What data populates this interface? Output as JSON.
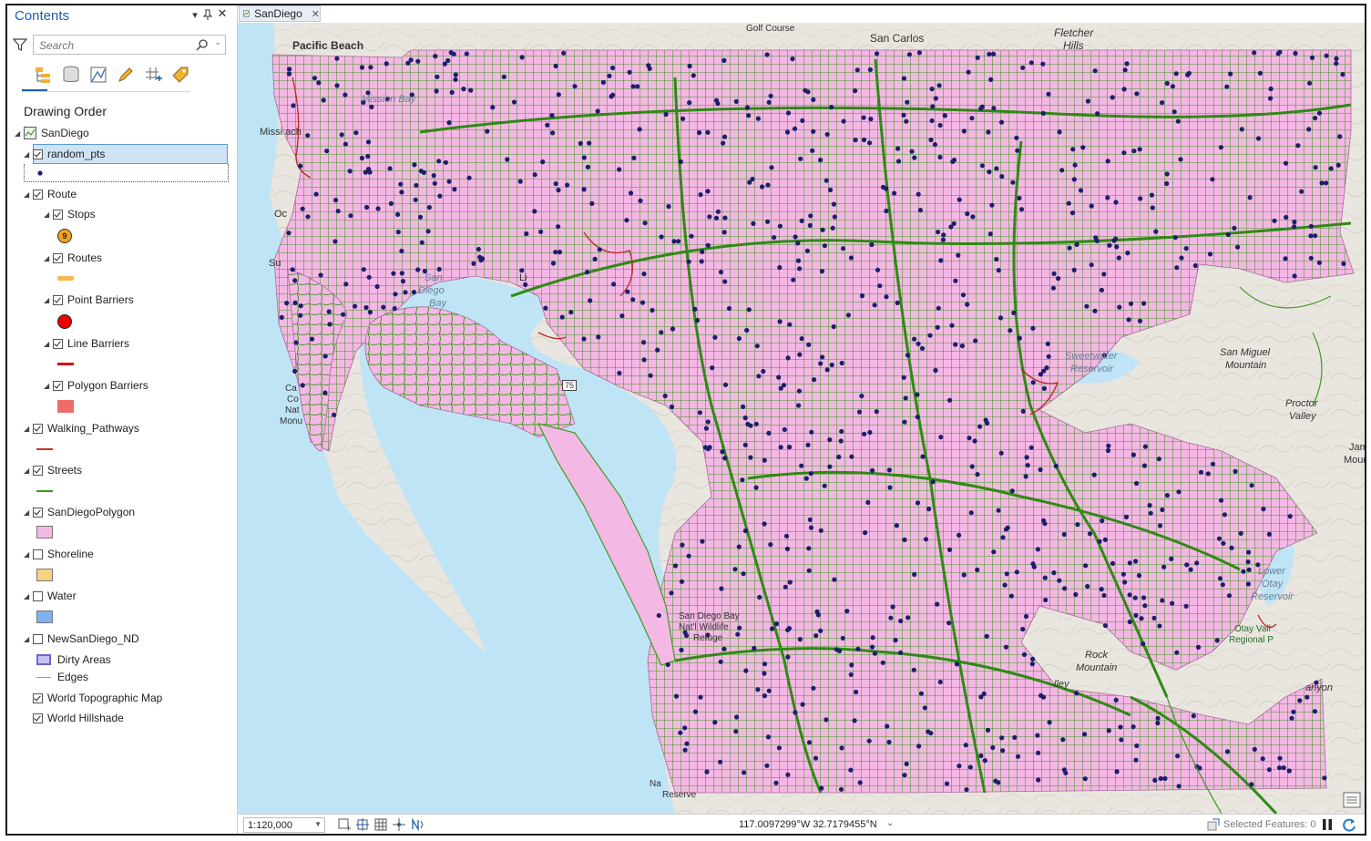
{
  "contents_pane": {
    "title": "Contents",
    "search_placeholder": "Search",
    "section_title": "Drawing Order",
    "layers": [
      {
        "name": "SanDiego"
      },
      {
        "name": "random_pts"
      },
      {
        "name": "Route"
      },
      {
        "name": "Stops",
        "symbol_label": "9"
      },
      {
        "name": "Routes"
      },
      {
        "name": "Point Barriers"
      },
      {
        "name": "Line Barriers"
      },
      {
        "name": "Polygon Barriers"
      },
      {
        "name": "Walking_Pathways"
      },
      {
        "name": "Streets"
      },
      {
        "name": "SanDiegoPolygon"
      },
      {
        "name": "Shoreline"
      },
      {
        "name": "Water"
      },
      {
        "name": "NewSanDiego_ND"
      },
      {
        "name": "Dirty Areas"
      },
      {
        "name": "Edges"
      },
      {
        "name": "World Topographic Map"
      },
      {
        "name": "World Hillshade"
      }
    ]
  },
  "map_view": {
    "tab_title": "SanDiego",
    "labels": {
      "pacific_beach": "Pacific Beach",
      "mission_bay": "Mission Bay",
      "mission_beach": "Missi         ach",
      "golf_course": "Golf Course",
      "san_carlos": "San Carlos",
      "fletcher_hills": "Fletcher",
      "fletcher_hills2": "Hills",
      "san_diego_bay1": "San",
      "san_diego_bay2": "Diego",
      "san_diego_bay3": "Bay",
      "sweetwater1": "Sweetwater",
      "sweetwater2": "Reservoir",
      "san_miguel1": "San Miguel",
      "san_miguel2": "Mountain",
      "proctor1": "Proctor",
      "proctor2": "Valley",
      "jamul1": "Jam",
      "jamul2": "Moun",
      "lower_otay1": "Lower",
      "lower_otay2": "Otay",
      "lower_otay3": "Reservoir",
      "otay_valley1": "Otay Vall",
      "otay_valley2": "Regional P",
      "refuge1": "San Diego Bay",
      "refuge2": "Nat'l Wildlife",
      "refuge3": "Refuge",
      "rock1": "Rock",
      "rock2": "Mountain",
      "canyon": "anyon",
      "reserve": "Reserve",
      "hwy": "75",
      "ocean_label": "Oc",
      "su_label": "Su",
      "li_label": "Li",
      "ca_label": "Ca",
      "co_label": "Co",
      "nat_label": "Nat",
      "monu_label": "Monu",
      "na_label": "Na",
      "lley_label": "lley"
    },
    "colors": {
      "city_polygon": "#f4b8e4",
      "streets": "#3e9b1f",
      "walking": "#b8281c",
      "points": "#1b1f6b",
      "water": "#bfe4f6"
    }
  },
  "status_bar": {
    "scale": "1:120,000",
    "coordinates": "117.0097299°W 32.7179455°N",
    "selected_features": "Selected Features: 0"
  }
}
